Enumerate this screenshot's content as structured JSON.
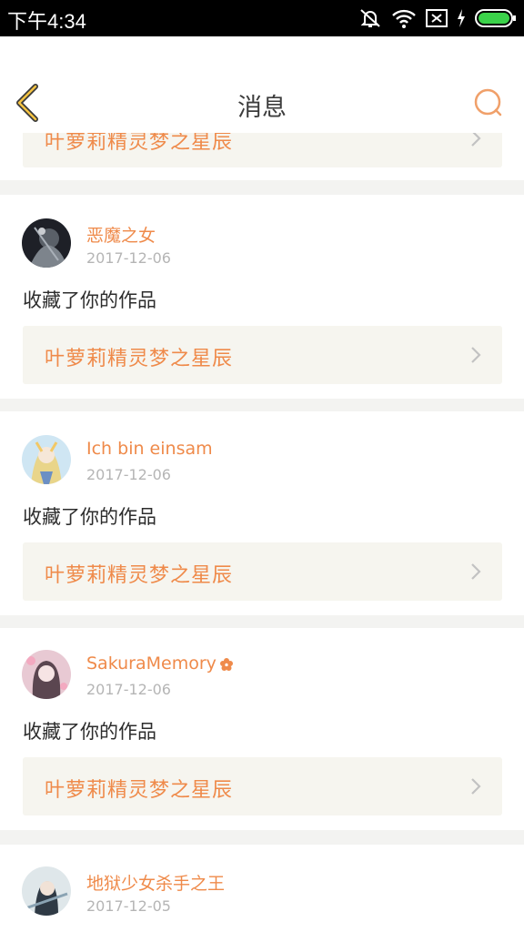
{
  "status_bar": {
    "time": "下午4:34"
  },
  "header": {
    "title": "消息"
  },
  "colors": {
    "accent": "#ef8a4a",
    "work_bg": "#f6f5ef",
    "page_bg": "#f3f3f1"
  },
  "top_partial_work": {
    "title": "叶萝莉精灵梦之星辰"
  },
  "messages": [
    {
      "username": "恶魔之女",
      "date": "2017-12-06",
      "action": "收藏了你的作品",
      "work_title": "叶萝莉精灵梦之星辰"
    },
    {
      "username": "Ich bin einsam",
      "date": "2017-12-06",
      "action": "收藏了你的作品",
      "work_title": "叶萝莉精灵梦之星辰"
    },
    {
      "username": "SakuraMemory",
      "date": "2017-12-06",
      "action": "收藏了你的作品",
      "work_title": "叶萝莉精灵梦之星辰",
      "vip_icon": "flower-badge-icon"
    },
    {
      "username": "地狱少女杀手之王",
      "date": "2017-12-05"
    }
  ]
}
